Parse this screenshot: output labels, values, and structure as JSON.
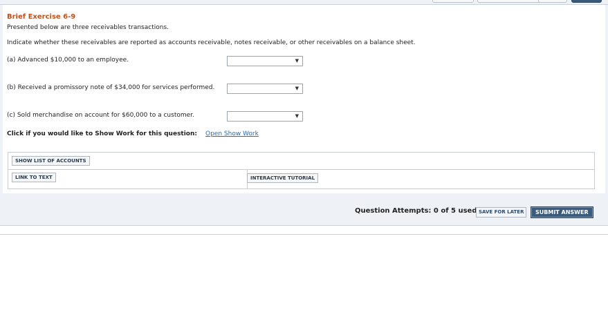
{
  "exercise": {
    "title": "Brief Exercise 6-9",
    "intro": "Presented below are three receivables transactions.",
    "instructions": "Indicate whether these receivables are reported as accounts receivable, notes receivable, or other receivables on a balance sheet.",
    "items": [
      {
        "label": "(a)  Advanced $10,000 to an employee.",
        "selected": ""
      },
      {
        "label": "(b)  Received a promissory note of $34,000 for services performed.",
        "selected": ""
      },
      {
        "label": "(c)  Sold merchandise on account for $60,000 to a customer.",
        "selected": ""
      }
    ],
    "show_work_prompt": "Click if you would like to Show Work for this question:",
    "show_work_link": "Open Show Work"
  },
  "tools": {
    "show_list": "SHOW LIST OF ACCOUNTS",
    "link_to_text": "LINK TO TEXT",
    "interactive_tutorial": "INTERACTIVE TUTORIAL"
  },
  "footer": {
    "attempts": "Question Attempts: 0 of 5 used",
    "save_label": "SAVE FOR LATER",
    "submit_label": "SUBMIT ANSWER"
  },
  "icons": {
    "dropdown": "chevron-down-icon"
  },
  "colors": {
    "title": "#c0501d",
    "link": "#2a6aa8",
    "submit_bg": "#3b5b7c"
  }
}
